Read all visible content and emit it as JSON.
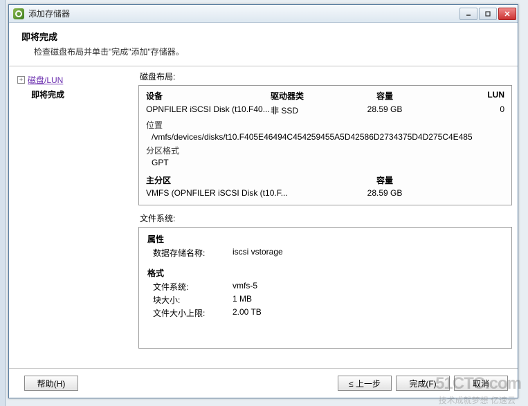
{
  "window": {
    "title": "添加存储器"
  },
  "header": {
    "title": "即将完成",
    "subtitle": "检查磁盘布局并单击\"完成\"添加\"存储器。"
  },
  "sidebar": {
    "items": [
      {
        "label": "磁盘/LUN",
        "link": true
      },
      {
        "label": "即将完成",
        "bold": true
      }
    ]
  },
  "disk_layout": {
    "section_label": "磁盘布局:",
    "headers": {
      "device": "设备",
      "driver_type": "驱动器类",
      "capacity": "容量",
      "lun": "LUN"
    },
    "row": {
      "device": "OPNFILER iSCSI Disk (t10.F40...",
      "driver_type": "非 SSD",
      "capacity": "28.59 GB",
      "lun": "0"
    },
    "location_label": "位置",
    "location_value": "/vmfs/devices/disks/t10.F405E46494C454259455A5D42586D2734375D4D275C4E485",
    "partfmt_label": "分区格式",
    "partfmt_value": "GPT",
    "partition_header": {
      "name": "主分区",
      "capacity": "容量"
    },
    "partition_row": {
      "name": "VMFS (OPNFILER iSCSI Disk (t10.F...",
      "capacity": "28.59 GB"
    }
  },
  "filesystem": {
    "section_label": "文件系统:",
    "attr_head": "属性",
    "ds_name_label": "数据存储名称:",
    "ds_name_value": "iscsi vstorage",
    "fmt_head": "格式",
    "fs_label": "文件系统:",
    "fs_value": "vmfs-5",
    "block_label": "块大小:",
    "block_value": "1 MB",
    "maxfile_label": "文件大小上限:",
    "maxfile_value": "2.00 TB"
  },
  "footer": {
    "help": "帮助(H)",
    "back": "≤ 上一步",
    "finish": "完成(F)",
    "cancel": "取消"
  },
  "watermark": {
    "main": "51CTO.com",
    "sub": "技术成就梦想  亿速云"
  }
}
